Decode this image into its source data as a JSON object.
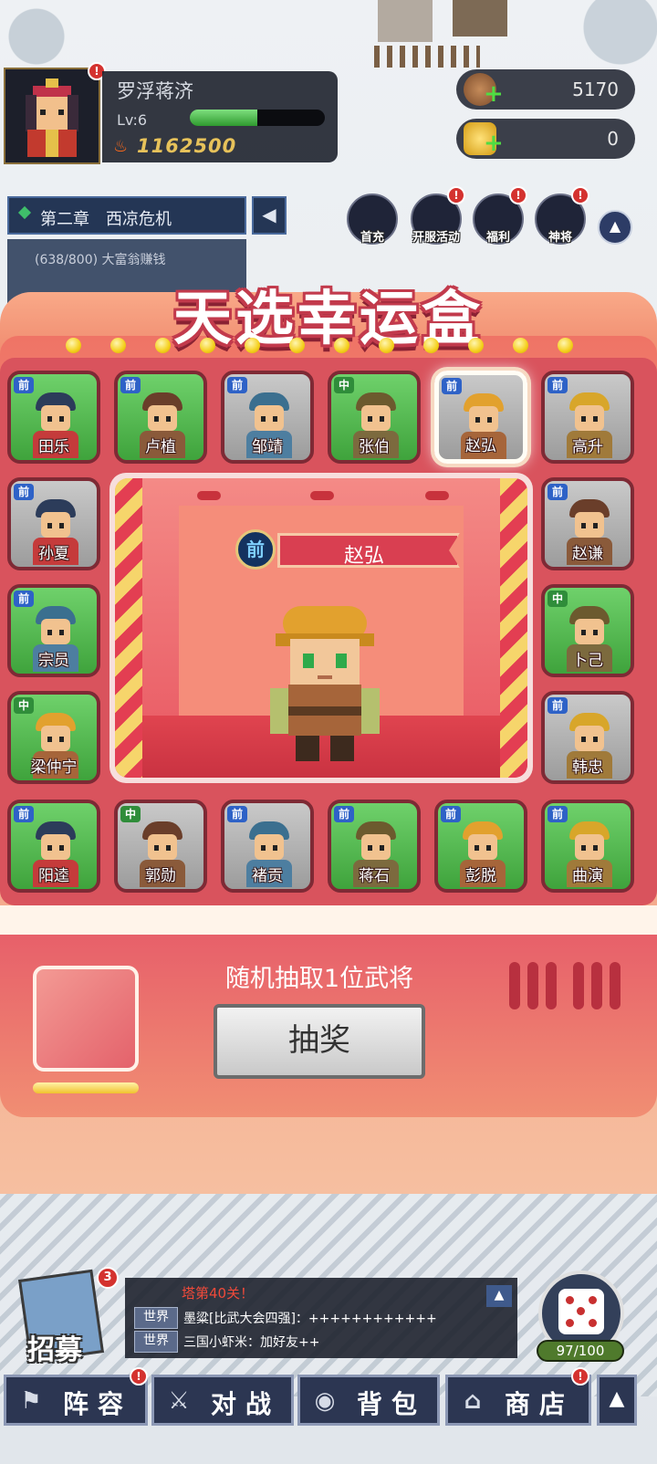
{
  "player": {
    "name": "罗浮蒋济",
    "level": "Lv:6",
    "xp_fraction": 0.5,
    "power": "1162500"
  },
  "currency": [
    {
      "icon": "coin-icon",
      "value": "5170"
    },
    {
      "icon": "gold-ingot-icon",
      "value": "0"
    }
  ],
  "chapter": {
    "title": "第二章　西凉危机",
    "quest": "(638/800) 大富翁赚钱"
  },
  "top_icons": [
    {
      "label": "首充",
      "icon": "first-recharge-icon",
      "badge": false
    },
    {
      "label": "开服活动",
      "icon": "gift-icon",
      "badge": true
    },
    {
      "label": "福利",
      "icon": "welfare-icon",
      "badge": true
    },
    {
      "label": "神将",
      "icon": "helmet-icon",
      "badge": true
    }
  ],
  "modal": {
    "title": "天选幸运盒",
    "heroes": [
      {
        "name": "田乐",
        "pos": "前",
        "bg": "green"
      },
      {
        "name": "卢植",
        "pos": "前",
        "bg": "green"
      },
      {
        "name": "邹靖",
        "pos": "前",
        "bg": "gray"
      },
      {
        "name": "张伯",
        "pos": "中",
        "bg": "green"
      },
      {
        "name": "赵弘",
        "pos": "前",
        "bg": "gray",
        "selected": true
      },
      {
        "name": "高升",
        "pos": "前",
        "bg": "gray"
      },
      {
        "name": "孙夏",
        "pos": "前",
        "bg": "gray"
      },
      {
        "name": "赵谦",
        "pos": "前",
        "bg": "gray"
      },
      {
        "name": "宗员",
        "pos": "前",
        "bg": "green"
      },
      {
        "name": "卜己",
        "pos": "中",
        "bg": "green"
      },
      {
        "name": "梁仲宁",
        "pos": "中",
        "bg": "green"
      },
      {
        "name": "韩忠",
        "pos": "前",
        "bg": "gray"
      },
      {
        "name": "阳逵",
        "pos": "前",
        "bg": "green"
      },
      {
        "name": "郭勋",
        "pos": "中",
        "bg": "gray"
      },
      {
        "name": "褚贡",
        "pos": "前",
        "bg": "gray"
      },
      {
        "name": "蒋石",
        "pos": "前",
        "bg": "green"
      },
      {
        "name": "彭脱",
        "pos": "前",
        "bg": "green"
      },
      {
        "name": "曲演",
        "pos": "前",
        "bg": "green"
      }
    ],
    "featured": {
      "pos": "前",
      "name": "赵弘"
    },
    "hint": "随机抽取1位武将",
    "draw_label": "抽奖"
  },
  "recruit": {
    "label": "招募",
    "badge": "3"
  },
  "chat": {
    "tower": "塔第40关！",
    "lines": [
      {
        "tab": "世界",
        "text": "墨粱[比武大会四强]：++++++++++++"
      },
      {
        "tab": "世界",
        "text": "三国小虾米：加好友++"
      }
    ]
  },
  "energy": "97/100",
  "nav": [
    {
      "label": "阵容",
      "icon": "flag-icon"
    },
    {
      "label": "对战",
      "icon": "crossed-swords-icon"
    },
    {
      "label": "背包",
      "icon": "bag-icon"
    },
    {
      "label": "商店",
      "icon": "shop-icon"
    }
  ]
}
